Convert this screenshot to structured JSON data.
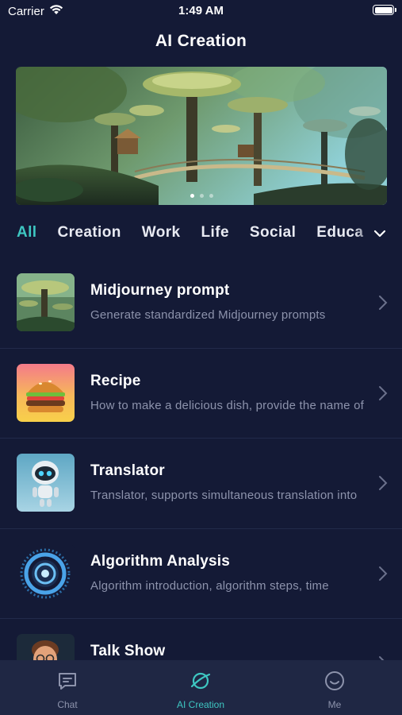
{
  "status_bar": {
    "carrier": "Carrier",
    "time": "1:49 AM",
    "icons": [
      "wifi-icon",
      "battery-icon"
    ]
  },
  "header": {
    "title": "AI Creation"
  },
  "banner": {
    "image": "fantasy-forest-mushroom-village",
    "page_count": 3,
    "active_page": 1
  },
  "categories": {
    "items": [
      "All",
      "Creation",
      "Work",
      "Life",
      "Social",
      "Educa"
    ],
    "active": "All",
    "expand_icon": "chevron-down-icon"
  },
  "list": {
    "items": [
      {
        "title": "Midjourney prompt",
        "description": "Generate standardized Midjourney prompts",
        "thumbnail": "fantasy-forest-thumbnail"
      },
      {
        "title": "Recipe",
        "description": "How to make a delicious dish, provide the name of",
        "thumbnail": "burger-thumbnail"
      },
      {
        "title": "Translator",
        "description": "Translator, supports simultaneous translation into",
        "thumbnail": "robot-thumbnail"
      },
      {
        "title": "Algorithm Analysis",
        "description": "Algorithm introduction, algorithm steps, time",
        "thumbnail": "digital-ring-thumbnail"
      },
      {
        "title": "Talk Show",
        "description": "",
        "thumbnail": "cartoon-man-thumbnail"
      }
    ]
  },
  "tab_bar": {
    "items": [
      {
        "label": "Chat",
        "icon": "chat-icon"
      },
      {
        "label": "AI Creation",
        "icon": "planet-icon"
      },
      {
        "label": "Me",
        "icon": "smiley-icon"
      }
    ],
    "active": "AI Creation"
  },
  "colors": {
    "background": "#141a36",
    "accent": "#3ec7c2",
    "secondary_text": "#8d93ac",
    "tab_bar_bg": "#1f2744"
  }
}
